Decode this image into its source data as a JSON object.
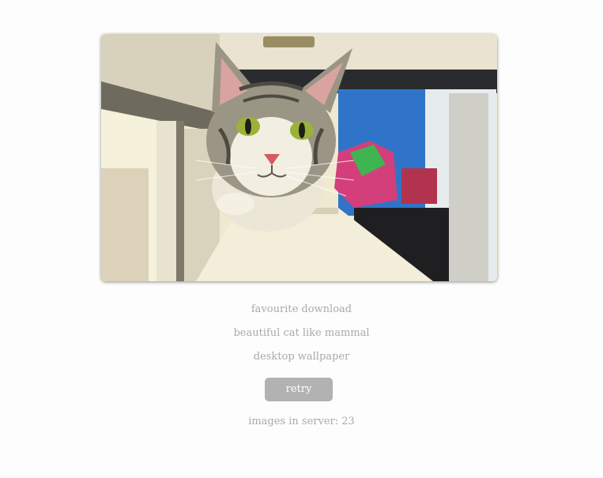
{
  "image": {
    "subject": "tabby cat peeking over a windowsill"
  },
  "captions": {
    "line1": "favourite download",
    "line2": "beautiful cat like mammal",
    "line3": "desktop wallpaper"
  },
  "retry_button": {
    "label": "retry"
  },
  "status": {
    "server_count": "images in server: 23"
  },
  "colors": {
    "caption_text": "#a9a9a9",
    "button_bg": "#b2b2b2",
    "button_text": "#ffffff",
    "page_bg": "#fdfdfd"
  }
}
